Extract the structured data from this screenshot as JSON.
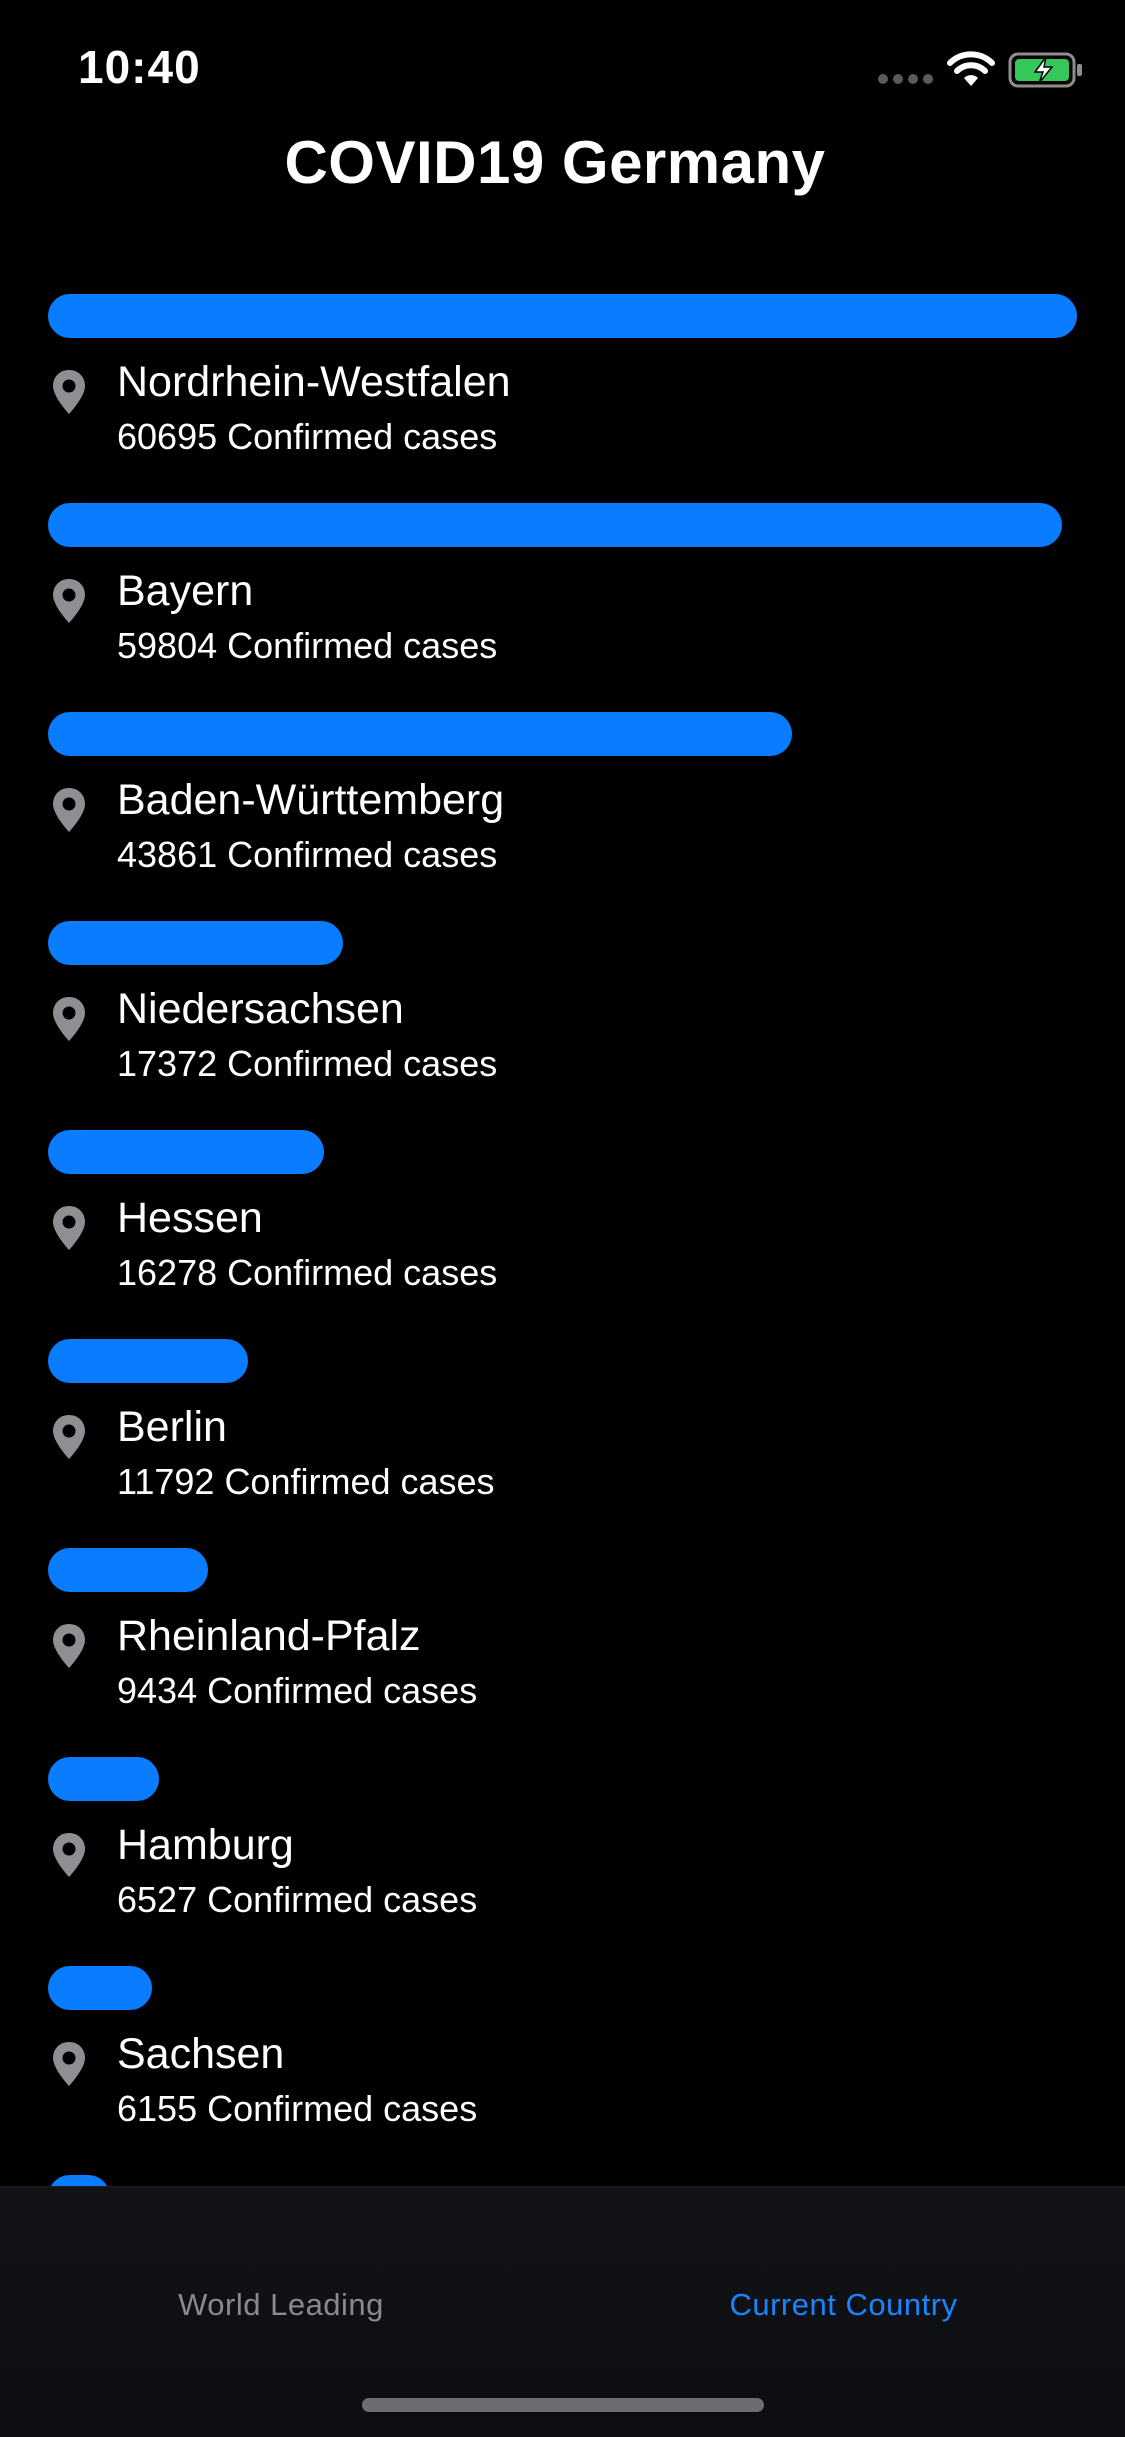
{
  "status_bar": {
    "time": "10:40"
  },
  "header": {
    "title": "COVID19 Germany"
  },
  "colors": {
    "background": "#000000",
    "bar": "#0a7cff",
    "tab_active": "#1a84ff",
    "tab_inactive": "#8a8a8d"
  },
  "cases_suffix": "Confirmed cases",
  "max_cases": 60695,
  "regions": [
    {
      "name": "Nordrhein-Westfalen",
      "cases": "60695"
    },
    {
      "name": "Bayern",
      "cases": "59804"
    },
    {
      "name": "Baden-Württemberg",
      "cases": "43861"
    },
    {
      "name": "Niedersachsen",
      "cases": "17372"
    },
    {
      "name": "Hessen",
      "cases": "16278"
    },
    {
      "name": "Berlin",
      "cases": "11792"
    },
    {
      "name": "Rheinland-Pfalz",
      "cases": "9434"
    },
    {
      "name": "Hamburg",
      "cases": "6527"
    },
    {
      "name": "Sachsen",
      "cases": "6155"
    },
    {
      "name": "",
      "cases": ""
    }
  ],
  "tabs": [
    {
      "label": "World Leading",
      "active": false
    },
    {
      "label": "Current Country",
      "active": true
    }
  ]
}
